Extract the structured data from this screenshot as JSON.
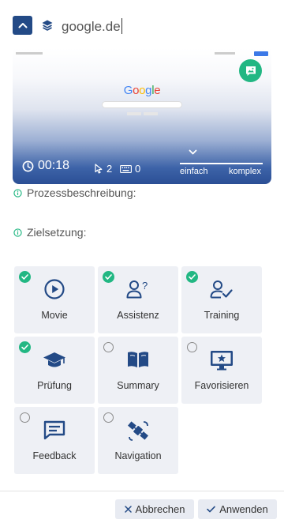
{
  "header": {
    "title": "google.de",
    "collapse_icon": "chevron-up-icon",
    "layers_icon": "layers-icon"
  },
  "preview": {
    "google_logo": [
      "G",
      "o",
      "o",
      "g",
      "l",
      "e"
    ],
    "snapshot_icon": "image-comment-icon",
    "timer": "00:18",
    "clicks": "2",
    "keystrokes": "0",
    "slider_left_label": "einfach",
    "slider_right_label": "komplex",
    "slider_value": 0.1
  },
  "fields": {
    "process_description": "Prozessbeschreibung:",
    "goal": "Zielsetzung:"
  },
  "options": [
    {
      "label": "Movie",
      "icon": "play-circle-icon",
      "checked": true
    },
    {
      "label": "Assistenz",
      "icon": "user-question-icon",
      "checked": true
    },
    {
      "label": "Training",
      "icon": "user-check-icon",
      "checked": true
    },
    {
      "label": "Prüfung",
      "icon": "graduation-cap-icon",
      "checked": true
    },
    {
      "label": "Summary",
      "icon": "open-book-icon",
      "checked": false
    },
    {
      "label": "Favorisieren",
      "icon": "monitor-star-icon",
      "checked": false
    },
    {
      "label": "Feedback",
      "icon": "chat-lines-icon",
      "checked": false
    },
    {
      "label": "Navigation",
      "icon": "satellite-icon",
      "checked": false
    }
  ],
  "footer": {
    "cancel_label": "Abbrechen",
    "apply_label": "Anwenden"
  },
  "colors": {
    "primary": "#234a86",
    "accent": "#22b783",
    "option_bg": "#eef0f5"
  }
}
